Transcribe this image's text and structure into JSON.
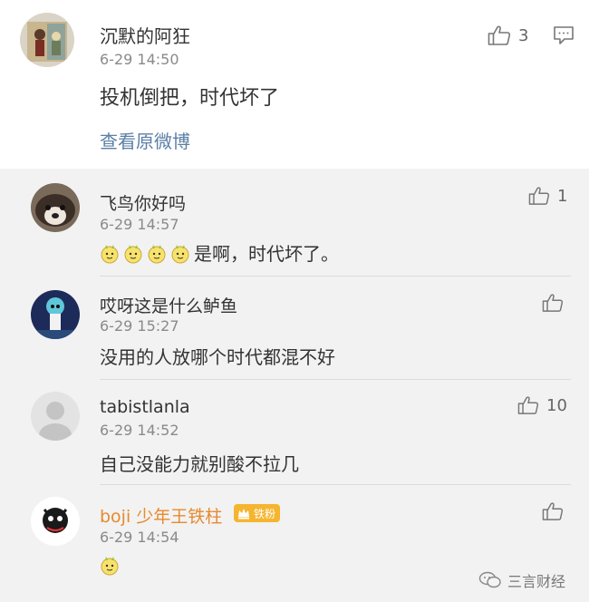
{
  "main_comment": {
    "username": "沉默的阿狂",
    "time": "6-29 14:50",
    "text": "投机倒把，时代坏了",
    "like_count": "3",
    "view_original": "查看原微博"
  },
  "replies": [
    {
      "username": "飞鸟你好吗",
      "time": "6-29 14:57",
      "text": "是啊，时代坏了。",
      "like_count": "1",
      "emoji": "doge-face-icon",
      "emoji_count": 4
    },
    {
      "username": "哎呀这是什么鲈鱼",
      "time": "6-29 15:27",
      "text": "没用的人放哪个时代都混不好",
      "like_count": ""
    },
    {
      "username": "tabistlanla",
      "time": "6-29 14:52",
      "text": "自己没能力就别酸不拉几",
      "like_count": "10"
    },
    {
      "username": "boji 少年王铁柱",
      "time": "6-29 14:54",
      "text": "",
      "like_count": "",
      "badge": "铁粉",
      "emoji": "doge-face-icon",
      "emoji_count": 1,
      "username_color": "#e8892c"
    }
  ],
  "watermark": "三言财经",
  "colors": {
    "link": "#5b7fa6",
    "badge": "#f5b52e",
    "vip_name": "#e8892c"
  }
}
